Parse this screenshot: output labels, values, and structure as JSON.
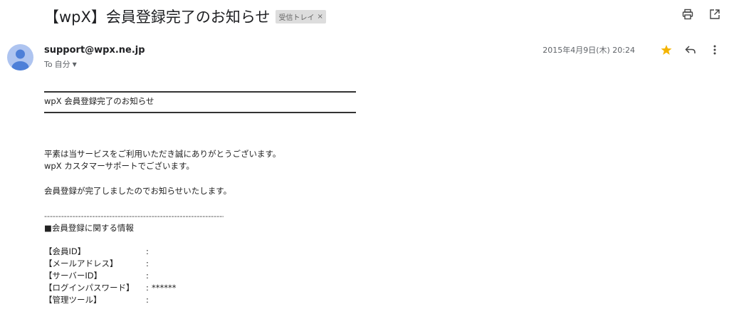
{
  "email": {
    "subject": "【wpX】会員登録完了のお知らせ",
    "label": "受信トレイ",
    "label_close": "×",
    "sender": "support@wpx.ne.jp",
    "recipient_prefix": "To",
    "recipient": "自分",
    "date": "2015年4月9日(木) 20:24",
    "body": {
      "heading": "wpX 会員登録完了のお知らせ",
      "lines": [
        "平素は当サービスをご利用いただき誠にありがとうございます。",
        "wpX カスタマーサポートでございます。"
      ],
      "notice": "会員登録が完了しましたのでお知らせいたします。",
      "separator": "-------------------------------------------------------------------",
      "section_title": "■会員登録に関する情報",
      "fields": [
        {
          "key": "【会員ID】",
          "sep": ":",
          "value": ""
        },
        {
          "key": "【メールアドレス】",
          "sep": ":",
          "value": ""
        },
        {
          "key": "【サーバーID】",
          "sep": ":",
          "value": ""
        },
        {
          "key": "【ログインパスワード】",
          "sep": ":",
          "value": "******"
        },
        {
          "key": "【管理ツール】",
          "sep": ":",
          "value": ""
        }
      ]
    }
  },
  "icons": {
    "print": "printer-icon",
    "open_new": "open-in-new-window-icon",
    "star": "star-icon",
    "reply": "reply-icon",
    "more": "more-vertical-icon",
    "avatar": "person-avatar-icon"
  },
  "colors": {
    "star": "#f4b400",
    "avatar_bg": "#aec4f0",
    "avatar_fg": "#4d7fd8",
    "label_bg": "#dddddd"
  }
}
